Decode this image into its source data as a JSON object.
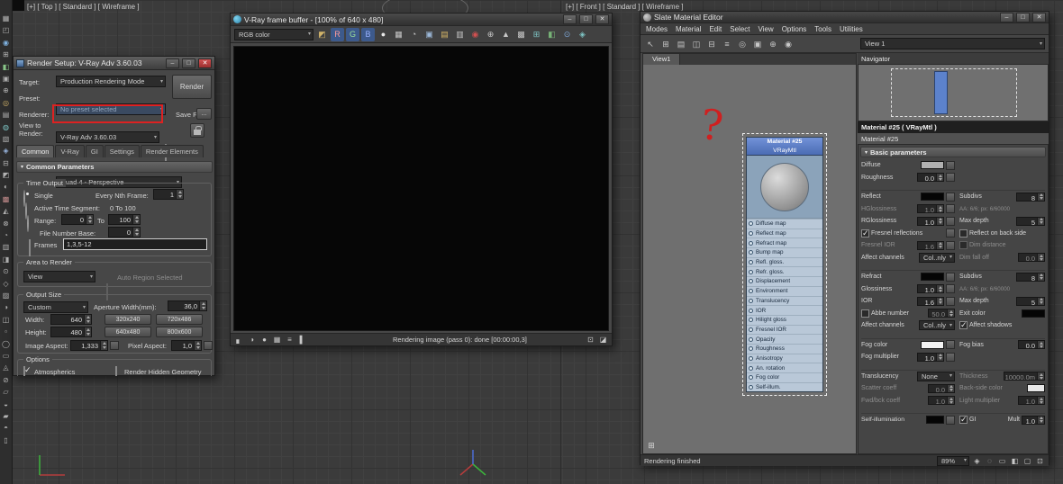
{
  "viewport": {
    "top_viewport_label": "[+] [ Top ] [ Standard ] [ Wireframe ]",
    "front_viewport_label": "[+] [ Front ] [ Standard ] [ Wireframe ]"
  },
  "annotation": {
    "question_mark": "?"
  },
  "left_toolbar": {
    "icons": [
      {
        "g": "▦"
      },
      {
        "g": "◰"
      },
      {
        "g": "◉",
        "c": "#7fb2e0"
      },
      {
        "g": "⊞"
      },
      {
        "g": "◧",
        "c": "#89c789"
      },
      {
        "g": "▣"
      },
      {
        "g": "⊕"
      },
      {
        "g": "◎",
        "c": "#d2b46a"
      },
      {
        "g": "▤"
      },
      {
        "g": "◍",
        "c": "#7fc7c7"
      },
      {
        "g": "▧"
      },
      {
        "g": "◈",
        "c": "#9ab7e0"
      },
      {
        "g": "⊟"
      },
      {
        "g": "◩"
      },
      {
        "g": "◐"
      },
      {
        "g": "▩",
        "c": "#c78f8f"
      },
      {
        "g": "◭"
      },
      {
        "g": "⊗"
      },
      {
        "g": "◔"
      },
      {
        "g": "▥"
      },
      {
        "g": "◨"
      },
      {
        "g": "⊙"
      },
      {
        "g": "◇"
      },
      {
        "g": "▨"
      },
      {
        "g": "◑"
      },
      {
        "g": "◫"
      },
      {
        "g": "▫"
      },
      {
        "g": "◯"
      },
      {
        "g": "▭"
      },
      {
        "g": "◬"
      },
      {
        "g": "⊘"
      },
      {
        "g": "▱"
      },
      {
        "g": "◒"
      },
      {
        "g": "▰"
      },
      {
        "g": "◓"
      },
      {
        "g": "▯"
      }
    ]
  },
  "render_setup": {
    "title": "Render Setup: V-Ray Adv 3.60.03",
    "target_label": "Target:",
    "target_value": "Production Rendering Mode",
    "render_button": "Render",
    "preset_label": "Preset:",
    "preset_value": "No preset selected",
    "renderer_label": "Renderer:",
    "renderer_value": "V-Ray Adv 3.60.03",
    "save_file_label": "Save File",
    "browse_label": "...",
    "view_label_1": "View to",
    "view_label_2": "Render:",
    "view_value": "Quad 4 - Perspective",
    "tabs": [
      "Common",
      "V-Ray",
      "GI",
      "Settings",
      "Render Elements"
    ],
    "rollout_common": "Common Parameters",
    "time_output": {
      "legend": "Time Output",
      "single": "Single",
      "nth_label": "Every Nth Frame:",
      "nth_value": "1",
      "active_label": "Active Time Segment:",
      "active_value": "0 To 100",
      "range_label": "Range:",
      "range_from": "0",
      "to_label": "To",
      "range_to": "100",
      "file_base_label": "File Number Base:",
      "file_base_value": "0",
      "frames_label": "Frames",
      "frames_value": "1,3,5-12"
    },
    "area": {
      "legend": "Area to Render",
      "view_value": "View",
      "auto_label": "Auto Region Selected"
    },
    "output": {
      "legend": "Output Size",
      "preset_value": "Custom",
      "aperture_label": "Aperture Width(mm):",
      "aperture_value": "36,0",
      "width_label": "Width:",
      "width_value": "640",
      "height_label": "Height:",
      "height_value": "480",
      "res_buttons": [
        "320x240",
        "720x486",
        "640x480",
        "800x600"
      ],
      "aspect_label": "Image Aspect:",
      "aspect_value": "1,333",
      "pixel_label": "Pixel Aspect:",
      "pixel_value": "1,0"
    },
    "options": {
      "legend": "Options",
      "atmospherics": "Atmospherics",
      "hidden_geometry": "Render Hidden Geometry"
    }
  },
  "vfb": {
    "title": "V-Ray frame buffer - [100% of 640 x 480]",
    "channel_value": "RGB color",
    "status_text": "Rendering image (pass 0): done [00:00:00,3]",
    "toolbar_icons": [
      {
        "g": "◩",
        "c": "#d2b46a"
      },
      {
        "g": "R",
        "c": "#ff9a9a",
        "b": "#3d5a8c"
      },
      {
        "g": "G",
        "c": "#9ade9a",
        "b": "#3d5a8c"
      },
      {
        "g": "B",
        "c": "#9ab2ff",
        "b": "#3d5a8c"
      },
      {
        "g": "●",
        "c": "#e8e8e8"
      },
      {
        "g": "▦",
        "c": "#c8c8c8"
      },
      {
        "g": "◔",
        "c": "#c8c8c8"
      },
      {
        "g": "▣",
        "c": "#9cb8d8"
      },
      {
        "g": "▤",
        "c": "#d8b868"
      },
      {
        "g": "▥",
        "c": "#c8c8c8"
      },
      {
        "g": "◉",
        "c": "#d05050"
      },
      {
        "g": "⊕",
        "c": "#c8c8c8"
      },
      {
        "g": "▲",
        "c": "#c8c8c8"
      },
      {
        "g": "▩",
        "c": "#c8c8c8"
      },
      {
        "g": "⊞",
        "c": "#7ec4c4"
      },
      {
        "g": "◧",
        "c": "#78b478"
      },
      {
        "g": "⊙",
        "c": "#7ea8d8"
      },
      {
        "g": "◈",
        "c": "#7ec4c4"
      }
    ],
    "status_icons": [
      {
        "g": "▖"
      },
      {
        "g": "◑"
      },
      {
        "g": "●"
      },
      {
        "g": "▦"
      },
      {
        "g": "≡"
      },
      {
        "g": "▌"
      }
    ],
    "corner_icons": [
      {
        "g": "⊡"
      },
      {
        "g": "◪"
      }
    ]
  },
  "slate": {
    "title": "Slate Material Editor",
    "menus": [
      "Modes",
      "Material",
      "Edit",
      "Select",
      "View",
      "Options",
      "Tools",
      "Utilities"
    ],
    "toolbar_icons": [
      {
        "g": "↖"
      },
      {
        "g": "⊞"
      },
      {
        "g": "▤"
      },
      {
        "g": "◫"
      },
      {
        "g": "⊟"
      },
      {
        "g": "≡"
      },
      {
        "g": "◎"
      },
      {
        "g": "▣"
      },
      {
        "g": "⊕"
      },
      {
        "g": "◉"
      }
    ],
    "view_dropdown": "View 1",
    "view_tab": "View1",
    "graph_corner_icon": "⊞",
    "navigator_title": "Navigator",
    "node": {
      "title": "Material #25",
      "subtitle": "VRayMtl",
      "slots": [
        "Diffuse map",
        "Reflect map",
        "Refract map",
        "Bump map",
        "Refl. gloss.",
        "Refr. gloss.",
        "Displacement",
        "Environment",
        "Translucency",
        "IOR",
        "Hilight gloss",
        "Fresnel IOR",
        "Opacity",
        "Roughness",
        "Anisotropy",
        "An. rotation",
        "Fog color",
        "Self-illum."
      ]
    },
    "params_header": "Material #25  ( VRayMtl )",
    "params_subheader": "Material #25",
    "rollout_basic": "Basic parameters",
    "p": {
      "diffuse": "Diffuse",
      "roughness": "Roughness",
      "roughness_v": "0,0",
      "reflect": "Reflect",
      "subdivs": "Subdivs",
      "subdivs_v": "8",
      "hglossiness": "HGlossiness",
      "hglossiness_v": "1,0",
      "aa": "AA: 6/6; px: 6/60000",
      "rglossiness": "RGlossiness",
      "rglossiness_v": "1,0",
      "max_depth": "Max depth",
      "max_depth_v": "5",
      "fresnel_refl": "Fresnel reflections",
      "reflect_back": "Reflect on back side",
      "fresnel_ior": "Fresnel IOR",
      "fresnel_ior_v": "1,6",
      "dim_distance": "Dim distance",
      "affect_channels": "Affect channels",
      "affect_channels_v": "Col..nly",
      "dim_falloff": "Dim fall off",
      "dim_falloff_v": "0,0",
      "refract": "Refract",
      "subdivs2_v": "8",
      "glossiness": "Glossiness",
      "glossiness_v": "1,0",
      "aa2": "AA: 6/6; px: 6/60000",
      "ior": "IOR",
      "ior_v": "1,6",
      "max_depth2_v": "5",
      "abbe": "Abbe number",
      "abbe_v": "50,0",
      "exit_color": "Exit color",
      "affect_channels2_v": "Col..nly",
      "affect_shadows": "Affect shadows",
      "fog_color": "Fog color",
      "fog_bias": "Fog bias",
      "fog_bias_v": "0,0",
      "fog_mult": "Fog multiplier",
      "fog_mult_v": "1,0",
      "translucency": "Translucency",
      "translucency_v": "None",
      "thickness": "Thickness",
      "thickness_v": "10000,0m",
      "scatter": "Scatter coeff",
      "scatter_v": "0,0",
      "backside": "Back-side color",
      "fwdbck": "Fwd/bck coeff",
      "fwdbck_v": "1,0",
      "light_mult": "Light multiplier",
      "light_mult_v": "1,0",
      "self_illum": "Self-illumination",
      "gi": "GI",
      "mult": "Mult",
      "mult_v": "1,0"
    },
    "status_text": "Rendering finished",
    "zoom": "89%",
    "status_icons": [
      {
        "g": "◈"
      },
      {
        "g": "◌"
      },
      {
        "g": "▭"
      },
      {
        "g": "◧"
      },
      {
        "g": "▢"
      },
      {
        "g": "⊡"
      }
    ]
  }
}
